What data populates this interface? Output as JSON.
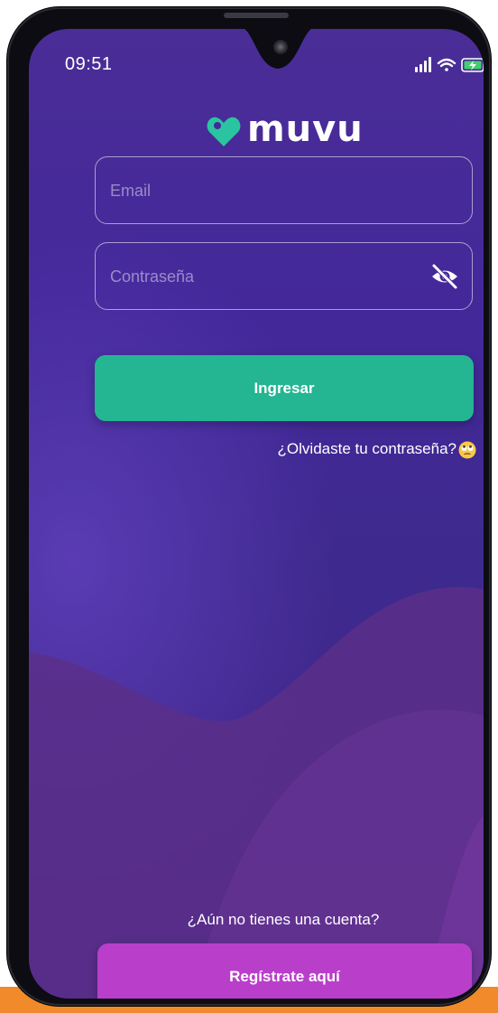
{
  "status_bar": {
    "time": "09:51",
    "icons": [
      "signal-icon",
      "wifi-icon",
      "battery-charging-icon"
    ]
  },
  "brand": {
    "name": "muvu",
    "logo_icon": "heart-tag-icon"
  },
  "login_form": {
    "email_placeholder": "Email",
    "email_value": "",
    "password_placeholder": "Contraseña",
    "password_value": "",
    "password_toggle_icon": "eye-off-icon",
    "submit_label": "Ingresar",
    "forgot_label": "¿Olvidaste tu contraseña?",
    "forgot_emoji": "rolling-eyes-emoji"
  },
  "register": {
    "prompt": "¿Aún no tienes una cuenta?",
    "button_label": "Regístrate aquí"
  },
  "colors": {
    "background": "#43289a",
    "primary_button": "#24b592",
    "register_button": "#b93fcb",
    "accent_orange": "#f08a2a"
  }
}
